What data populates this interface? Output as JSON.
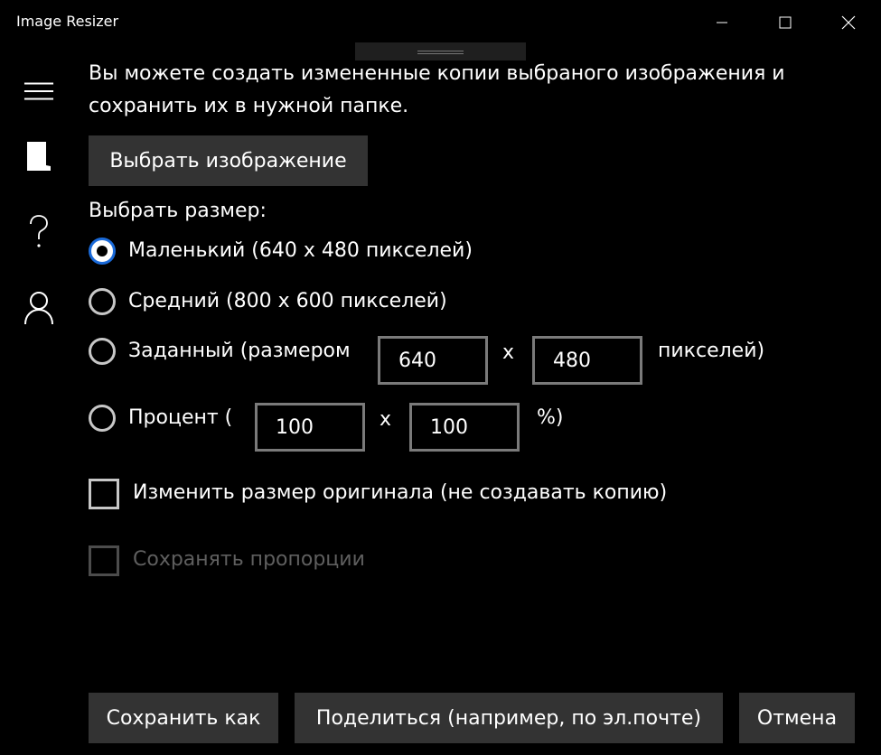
{
  "window": {
    "title": "Image Resizer"
  },
  "nav": {
    "menu_icon": "hamburger-menu-icon",
    "items": [
      {
        "icon": "document-icon"
      },
      {
        "icon": "help-icon"
      },
      {
        "icon": "user-icon"
      }
    ]
  },
  "main": {
    "description": "Вы можете создать измененные копии выбраного изображения и сохранить их в нужной папке.",
    "choose_image_label": "Выбрать изображение",
    "size_heading": "Выбрать размер:",
    "options": {
      "small": "Маленький (640 x 480 пикселей)",
      "medium": "Средний (800 x 600 пикселей)",
      "custom_prefix": "Заданный (размером",
      "custom_width": "640",
      "custom_separator": "x",
      "custom_height": "480",
      "custom_suffix": "пикселей)",
      "percent_prefix": "Процент (",
      "percent_width": "100",
      "percent_separator": "x",
      "percent_height": "100",
      "percent_suffix": "%)",
      "selected": "small"
    },
    "resize_original_label": "Изменить размер оригинала (не создавать копию)",
    "keep_proportions_label": "Сохранять пропорции"
  },
  "footer": {
    "save_as_label": "Сохранить как",
    "share_label": "Поделиться (например, по эл.почте)",
    "cancel_label": "Отмена"
  },
  "colors": {
    "background": "#000000",
    "accent": "#1a6ad9",
    "button": "#333333"
  }
}
